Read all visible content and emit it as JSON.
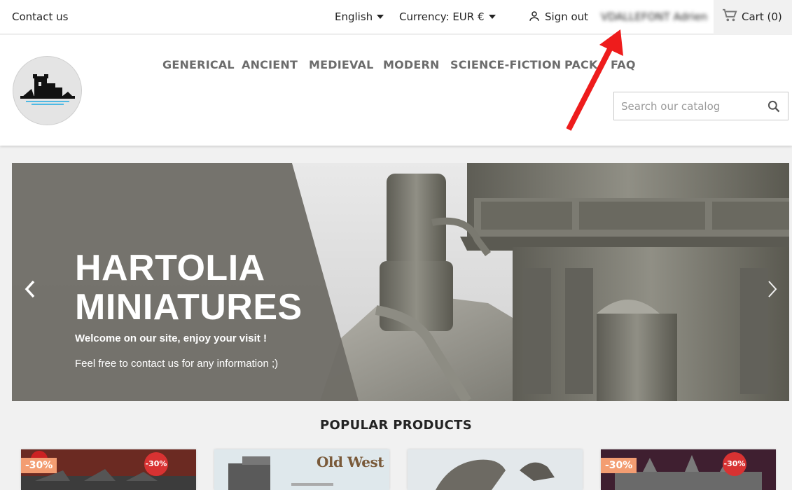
{
  "topbar": {
    "contact": "Contact us",
    "language": "English",
    "currency_label": "Currency:",
    "currency_value": "EUR €",
    "signout": "Sign out",
    "username": "VDALLEFONT Adrien",
    "cart": "Cart (0)"
  },
  "nav": {
    "items": [
      "GENERICAL",
      "ANCIENT",
      "MEDIEVAL",
      "MODERN",
      "SCIENCE-FICTION",
      "PACK",
      "FAQ"
    ]
  },
  "search": {
    "placeholder": "Search our catalog"
  },
  "hero": {
    "title_line1": "HARTOLIA",
    "title_line2": "MINIATURES",
    "text1": "Welcome on our site, enjoy your visit !",
    "text2": "Feel free to contact us for any information ;)"
  },
  "popular": {
    "title": "POPULAR PRODUCTS",
    "products": [
      {
        "badge": "-30%",
        "circle_badge": "-30%"
      },
      {
        "title": "Old West"
      },
      {},
      {
        "badge": "-30%",
        "circle_badge": "-30%"
      }
    ]
  },
  "colors": {
    "accent_badge": "#f39d72",
    "discount_red": "#d83232",
    "annotation_arrow": "#ee1c1c"
  }
}
